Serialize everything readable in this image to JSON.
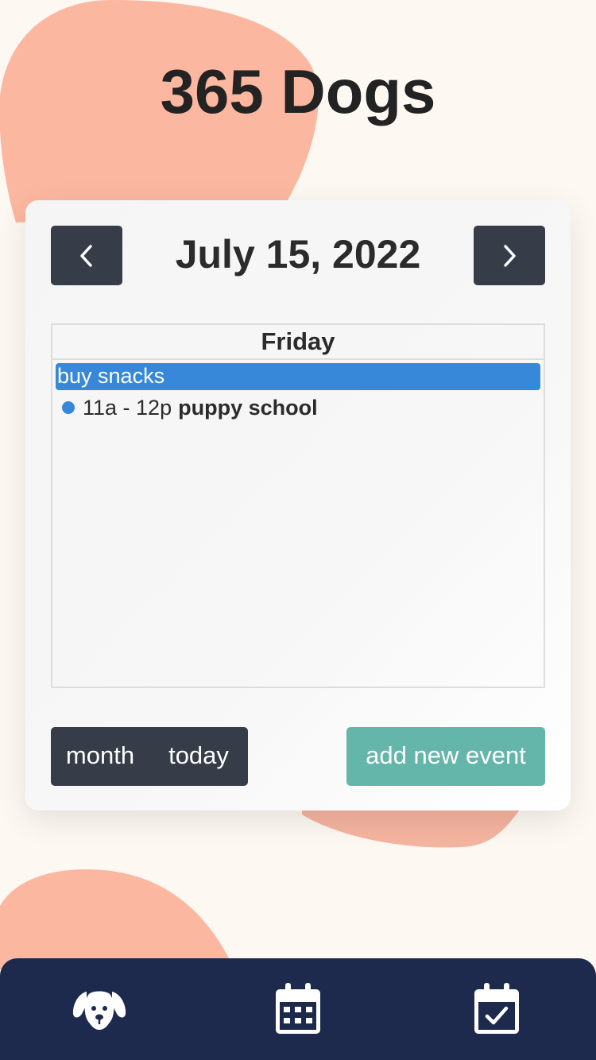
{
  "app": {
    "title": "365 Dogs"
  },
  "calendar": {
    "date_title": "July 15, 2022",
    "prev_icon": "chevron-left-icon",
    "next_icon": "chevron-right-icon",
    "day_header": "Friday",
    "all_day_events": [
      {
        "title": "buy snacks",
        "color": "#3788d8"
      }
    ],
    "timed_events": [
      {
        "time": "11a - 12p",
        "title": "puppy school",
        "color": "#3788d8"
      }
    ]
  },
  "views": {
    "month_label": "month",
    "today_label": "today"
  },
  "actions": {
    "add_event_label": "add new event"
  },
  "bottom_nav": {
    "tabs": [
      {
        "icon": "dog-icon"
      },
      {
        "icon": "calendar-icon"
      },
      {
        "icon": "calendar-check-icon"
      }
    ]
  },
  "colors": {
    "background": "#fdf8f2",
    "blob": "#fcb7a0",
    "dark_button": "#363d48",
    "accent_teal": "#65b6aa",
    "event_blue": "#3788d8",
    "nav_bar": "#1e2a4d"
  }
}
